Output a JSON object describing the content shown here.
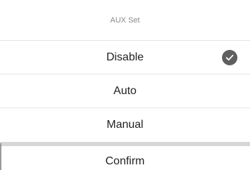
{
  "sheet": {
    "title": "AUX Set",
    "options": [
      {
        "label": "Disable",
        "selected": true
      },
      {
        "label": "Auto",
        "selected": false
      },
      {
        "label": "Manual",
        "selected": false
      }
    ],
    "confirm_label": "Confirm",
    "check_icon": "checkmark-circle-icon"
  },
  "colors": {
    "title_text": "#8a8a8a",
    "option_text": "#222222",
    "check_bg": "#5f5f5f",
    "separator": "#d6d6d9"
  }
}
